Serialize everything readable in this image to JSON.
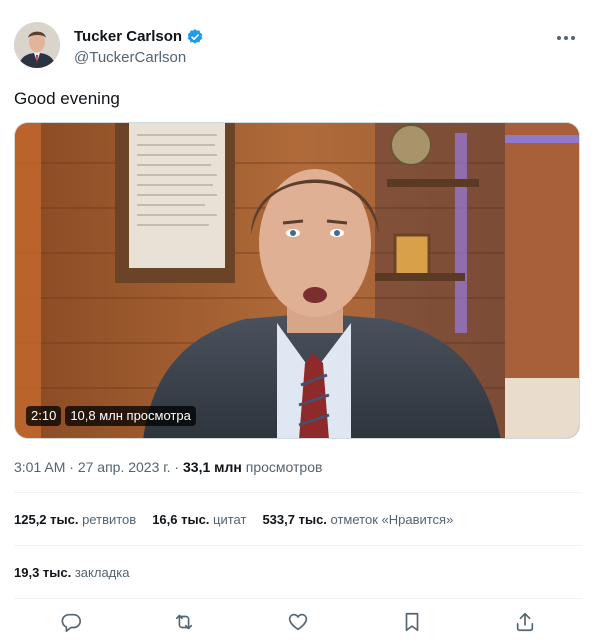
{
  "author": {
    "display_name": "Tucker Carlson",
    "handle": "@TuckerCarlson"
  },
  "tweet": {
    "text": "Good evening"
  },
  "video": {
    "duration": "2:10",
    "views": "10,8 млн просмотра"
  },
  "meta": {
    "time": "3:01 AM",
    "sep": " · ",
    "date": "27 апр. 2023 г.",
    "sep2": " · ",
    "views_count": "33,1 млн",
    "views_label": " просмотров"
  },
  "stats": {
    "retweets_count": "125,2 тыс.",
    "retweets_label": " ретвитов",
    "quotes_count": "16,6 тыс.",
    "quotes_label": " цитат",
    "likes_count": "533,7 тыс.",
    "likes_label": " отметок «Нравится»",
    "bookmarks_count": "19,3 тыс.",
    "bookmarks_label": " закладка"
  },
  "icons": {
    "more": "more-icon",
    "verified": "verified-badge-icon",
    "reply": "reply-icon",
    "retweet": "retweet-icon",
    "like": "heart-icon",
    "bookmark": "bookmark-icon",
    "share": "share-icon"
  },
  "colors": {
    "verified": "#1d9bf0",
    "secondary_text": "#536471",
    "primary_text": "#0f1419"
  }
}
